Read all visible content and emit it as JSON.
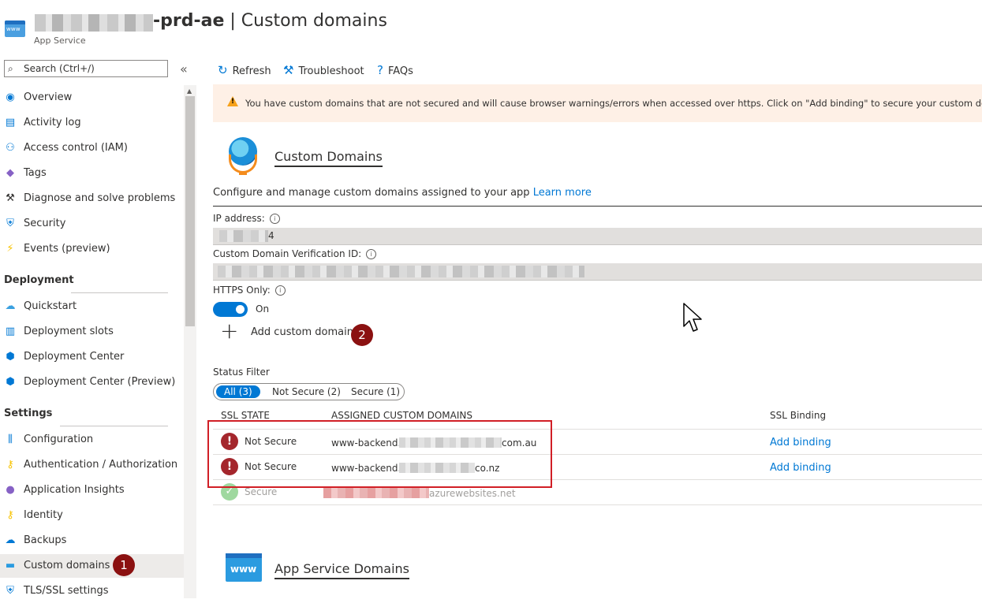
{
  "header": {
    "icon": "app-service-icon",
    "icon_text": "www",
    "title_suffix": "-prd-ae",
    "title_separator": " | ",
    "title_page": "Custom domains",
    "subtitle": "App Service"
  },
  "sidebar": {
    "search_placeholder": "Search (Ctrl+/)",
    "collapse_glyph": "«",
    "items_top": [
      {
        "label": "Overview",
        "icon": "overview-icon",
        "glyph": "◉",
        "color": "#0078d4"
      },
      {
        "label": "Activity log",
        "icon": "activity-log-icon",
        "glyph": "▤",
        "color": "#0078d4"
      },
      {
        "label": "Access control (IAM)",
        "icon": "iam-icon",
        "glyph": "⚇",
        "color": "#0078d4"
      },
      {
        "label": "Tags",
        "icon": "tag-icon",
        "glyph": "◆",
        "color": "#8661c5"
      },
      {
        "label": "Diagnose and solve problems",
        "icon": "wrench-icon",
        "glyph": "⚒",
        "color": "#323130"
      },
      {
        "label": "Security",
        "icon": "shield-icon",
        "glyph": "⛨",
        "color": "#0078d4"
      },
      {
        "label": "Events (preview)",
        "icon": "lightning-icon",
        "glyph": "⚡",
        "color": "#f7c300"
      }
    ],
    "deployment_heading": "Deployment",
    "items_deployment": [
      {
        "label": "Quickstart",
        "icon": "cloud-icon",
        "glyph": "☁",
        "color": "#3aa0e0"
      },
      {
        "label": "Deployment slots",
        "icon": "deployment-slots-icon",
        "glyph": "▥",
        "color": "#0078d4"
      },
      {
        "label": "Deployment Center",
        "icon": "cube-icon",
        "glyph": "⬢",
        "color": "#0078d4"
      },
      {
        "label": "Deployment Center (Preview)",
        "icon": "cube-icon",
        "glyph": "⬢",
        "color": "#0078d4"
      }
    ],
    "settings_heading": "Settings",
    "items_settings": [
      {
        "label": "Configuration",
        "icon": "sliders-icon",
        "glyph": "⫼",
        "color": "#0078d4"
      },
      {
        "label": "Authentication / Authorization",
        "icon": "key-icon",
        "glyph": "⚷",
        "color": "#f7c300"
      },
      {
        "label": "Application Insights",
        "icon": "lightbulb-icon",
        "glyph": "●",
        "color": "#8661c5"
      },
      {
        "label": "Identity",
        "icon": "identity-key-icon",
        "glyph": "⚷",
        "color": "#f7c300"
      },
      {
        "label": "Backups",
        "icon": "backup-cloud-icon",
        "glyph": "☁",
        "color": "#0078d4"
      },
      {
        "label": "Custom domains",
        "icon": "www-icon",
        "glyph": "▬",
        "color": "#2b9be0"
      },
      {
        "label": "TLS/SSL settings",
        "icon": "tls-shield-icon",
        "glyph": "⛨",
        "color": "#0078d4"
      }
    ],
    "badge_1": "1"
  },
  "toolbar": {
    "refresh": "Refresh",
    "troubleshoot": "Troubleshoot",
    "faqs": "FAQs"
  },
  "banner": {
    "text": "You have custom domains that are not secured and will cause browser warnings/errors when accessed over https. Click on \"Add binding\" to secure your custom domains. →",
    "warn_glyph": "!"
  },
  "custom_domains": {
    "title": "Custom Domains",
    "description": "Configure and manage custom domains assigned to your app",
    "learn_more": "Learn more",
    "ip_label": "IP address:",
    "ip_value_visible": "4",
    "verification_label": "Custom Domain Verification ID:",
    "https_label": "HTTPS Only:",
    "https_state": "On",
    "add_domain": "Add custom domain",
    "badge_2": "2",
    "status_filter_label": "Status Filter",
    "filters": [
      "All (3)",
      "Not Secure (2)",
      "Secure (1)"
    ]
  },
  "table": {
    "headers": {
      "ssl_state": "SSL STATE",
      "domains": "ASSIGNED CUSTOM DOMAINS",
      "binding": "SSL Binding"
    },
    "rows": [
      {
        "state": "Not Secure",
        "domain_prefix": "www-backend.",
        "domain_suffix": "com.au",
        "binding": "Add binding"
      },
      {
        "state": "Not Secure",
        "domain_prefix": "www-backend.",
        "domain_suffix": "co.nz",
        "binding": "Add binding"
      },
      {
        "state": "Secure",
        "domain_prefix": "",
        "domain_suffix": "azurewebsites.net",
        "binding": ""
      }
    ]
  },
  "app_service_domains": {
    "title": "App Service Domains",
    "icon_text": "www"
  }
}
